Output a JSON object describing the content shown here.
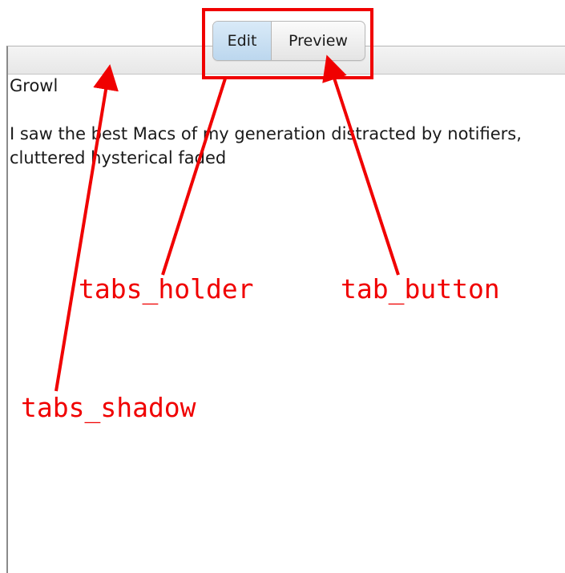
{
  "tabs": {
    "edit_label": "Edit",
    "preview_label": "Preview",
    "active": "Edit"
  },
  "document": {
    "title": "Growl",
    "body": "I saw the best Macs of my generation distracted by notifiers, cluttered hysterical faded"
  },
  "annotations": {
    "tabs_holder": "tabs_holder",
    "tab_button": "tab_button",
    "tabs_shadow": "tabs_shadow",
    "color": "#f00000"
  },
  "colors": {
    "active_tab": "#c9e0f3",
    "frame_border": "#8a8a8a"
  }
}
